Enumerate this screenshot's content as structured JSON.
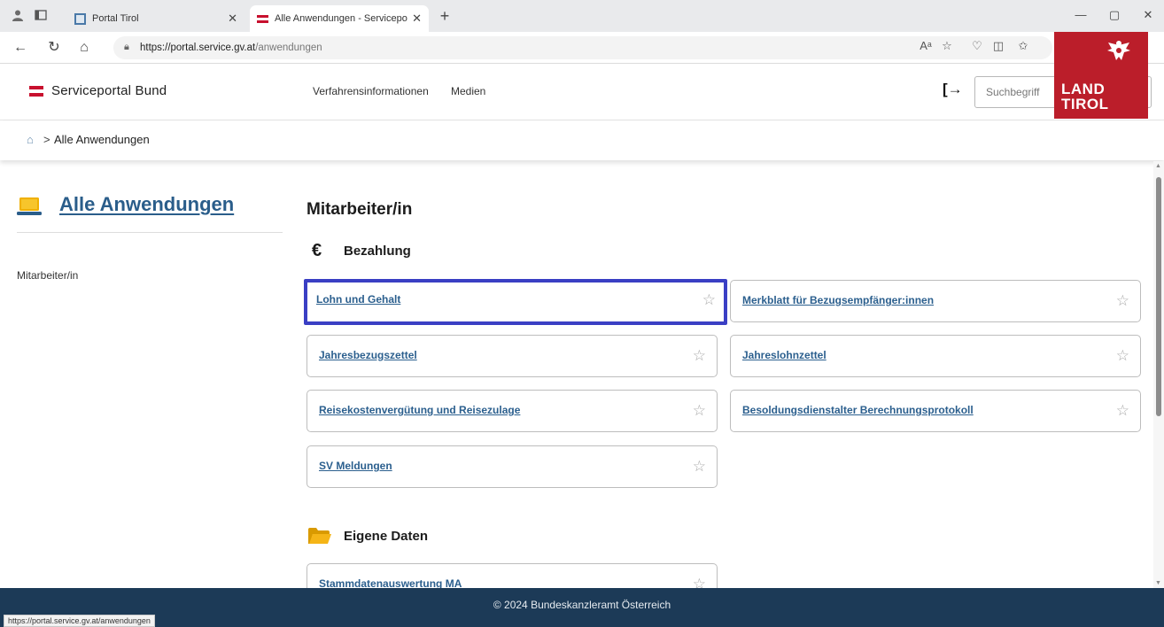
{
  "browser": {
    "tabs": [
      {
        "label": "Portal Tirol",
        "active": false
      },
      {
        "label": "Alle Anwendungen - Serviceportal",
        "active": true
      }
    ],
    "url_host": "https://portal.service.gv.at",
    "url_path": "/anwendungen",
    "status_url": "https://portal.service.gv.at/anwendungen"
  },
  "header": {
    "brand": "Serviceportal Bund",
    "nav": [
      "Verfahrensinformationen",
      "Medien"
    ],
    "search_placeholder": "Suchbegriff",
    "tirol_logo_text": [
      "LAND",
      "TIROL"
    ],
    "flag_colors": [
      "#c8102e",
      "#ffffff",
      "#c8102e"
    ]
  },
  "breadcrumb": {
    "current": "Alle Anwendungen"
  },
  "sidebar": {
    "title": "Alle Anwendungen",
    "items": [
      "Mitarbeiter/in"
    ]
  },
  "main": {
    "title": "Mitarbeiter/in",
    "sections": [
      {
        "title": "Bezahlung",
        "icon": "euro-icon",
        "items": [
          "Lohn und Gehalt",
          "Merkblatt für Bezugsempfänger:innen",
          "Jahresbezugszettel",
          "Jahreslohnzettel",
          "Reisekostenvergütung und Reisezulage",
          "Besoldungsdienstalter Berechnungsprotokoll",
          "SV Meldungen"
        ]
      },
      {
        "title": "Eigene Daten",
        "icon": "folder-icon",
        "items": [
          "Stammdatenauswertung MA"
        ]
      }
    ]
  },
  "footer": {
    "text": "© 2024 Bundeskanzleramt Österreich"
  },
  "colors": {
    "link": "#2b5f8e",
    "focus": "#3a3fc4",
    "footer_bg": "#1c3a57",
    "tirol_red": "#bb1e2a"
  }
}
